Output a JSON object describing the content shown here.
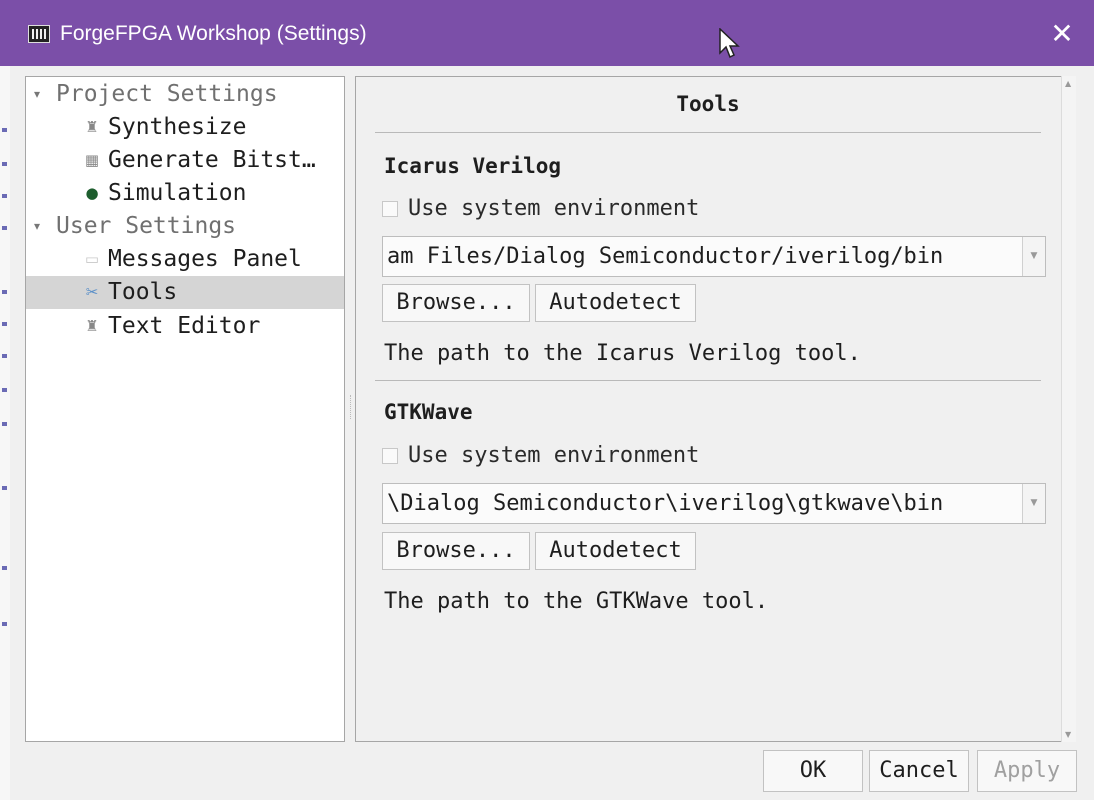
{
  "window": {
    "title": "ForgeFPGA Workshop (Settings)",
    "app_icon": "chip-icon",
    "close_glyph": "✕"
  },
  "tree": {
    "items": [
      {
        "label": "Project Settings",
        "type": "group",
        "arrow": "▾"
      },
      {
        "label": "Synthesize",
        "type": "item",
        "icon": "flask-icon",
        "glyph": "♜"
      },
      {
        "label": "Generate Bitst…",
        "type": "item",
        "icon": "bitstream-icon",
        "glyph": "▦"
      },
      {
        "label": "Simulation",
        "type": "item",
        "icon": "simulation-icon",
        "glyph": "●"
      },
      {
        "label": "User Settings",
        "type": "group",
        "arrow": "▾"
      },
      {
        "label": "Messages Panel",
        "type": "item",
        "icon": "message-icon",
        "glyph": "▭"
      },
      {
        "label": "Tools",
        "type": "item",
        "icon": "tools-icon",
        "glyph": "✂",
        "selected": true
      },
      {
        "label": "Text Editor",
        "type": "item",
        "icon": "text-editor-icon",
        "glyph": "♜"
      }
    ]
  },
  "content": {
    "header": "Tools",
    "icarus": {
      "title": "Icarus Verilog",
      "checkbox_label": "Use system environment",
      "path": "am Files/Dialog Semiconductor/iverilog/bin",
      "browse": "Browse...",
      "autodetect": "Autodetect",
      "description": "The path to the Icarus Verilog tool."
    },
    "gtkwave": {
      "title": "GTKWave",
      "checkbox_label": "Use system environment",
      "path": "\\Dialog Semiconductor\\iverilog\\gtkwave\\bin",
      "browse": "Browse...",
      "autodetect": "Autodetect",
      "description": "The path to the GTKWave tool."
    }
  },
  "footer": {
    "ok": "OK",
    "cancel": "Cancel",
    "apply": "Apply"
  }
}
